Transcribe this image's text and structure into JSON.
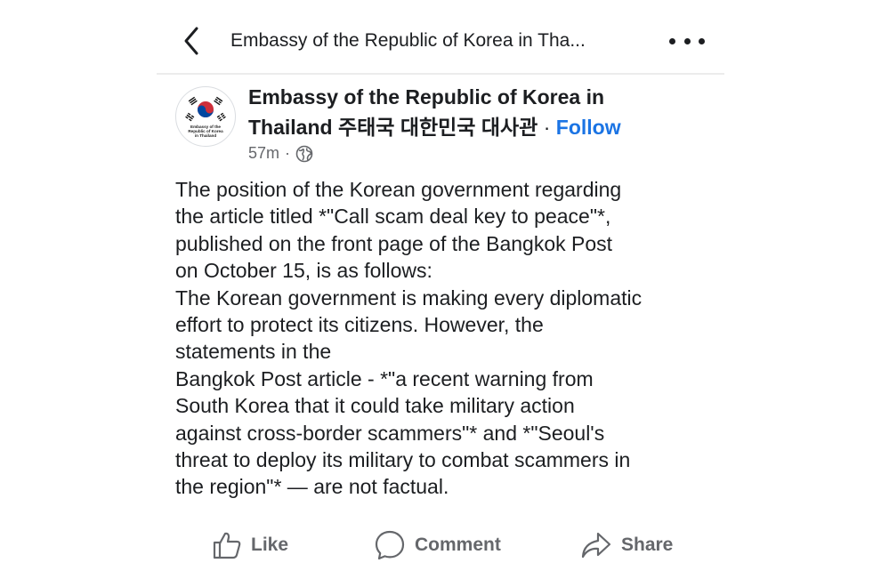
{
  "header": {
    "title": "Embassy of the Republic of Korea in Tha...",
    "back_icon": "chevron-left-icon",
    "more_icon": "more-dots-icon"
  },
  "post": {
    "avatar": {
      "icon": "korean-flag-seal",
      "caption_lines": [
        "Embassy of the",
        "Republic of Korea",
        "in Thailand"
      ]
    },
    "author_line1": "Embassy of the Republic of Korea in",
    "author_line2": "Thailand 주태국 대한민국 대사관",
    "separator": " · ",
    "follow_label": "Follow",
    "time": "57m",
    "time_separator": "·",
    "audience_icon": "globe-icon",
    "body_lines": [
      "The position of the Korean government regarding",
      "the article titled *\"Call scam deal key to peace\"*,",
      "published on the front page of the Bangkok Post",
      "on October 15, is as follows:",
      "The Korean government is making every diplomatic",
      "effort to protect its citizens. However, the",
      "statements in the",
      "Bangkok Post article - *\"a recent warning from",
      "South Korea that it could take military action",
      "against cross-border scammers\"* and *\"Seoul's",
      "threat to deploy its military to combat scammers in",
      "the region\"* — are not factual."
    ]
  },
  "actions": {
    "like_label": "Like",
    "comment_label": "Comment",
    "share_label": "Share"
  },
  "colors": {
    "accent": "#1b74e4",
    "secondary_text": "#65676b",
    "primary_text": "#1c1e21"
  }
}
